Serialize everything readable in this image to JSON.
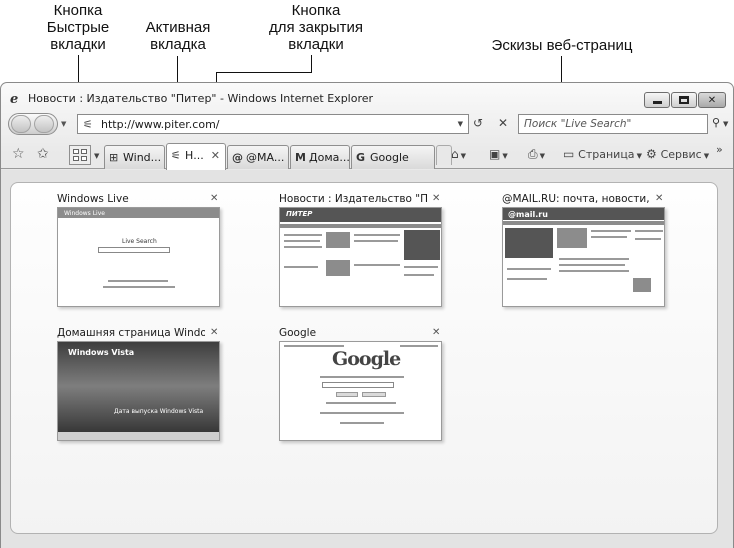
{
  "annotations": {
    "quick_tabs_button": [
      "Кнопка",
      "Быстрые",
      "вкладки"
    ],
    "active_tab": [
      "Активная",
      "вкладка"
    ],
    "close_tab_button": [
      "Кнопка",
      "для закрытия",
      "вкладки"
    ],
    "web_page_thumbnails": [
      "Эскизы веб-страниц"
    ]
  },
  "window": {
    "title": "Новости : Издательство \"Питер\" - Windows Internet Explorer"
  },
  "address_bar": {
    "url": "http://www.piter.com/"
  },
  "search": {
    "placeholder": "Поиск \"Live Search\""
  },
  "tabs": [
    {
      "label": "Wind...",
      "icon": "windows-icon",
      "active": false
    },
    {
      "label": "Н...",
      "icon": "piter-icon",
      "active": true
    },
    {
      "label": "@MA...",
      "icon": "at-icon",
      "active": false
    },
    {
      "label": "Дома...",
      "icon": "msn-icon",
      "active": false
    },
    {
      "label": "Google",
      "icon": "google-icon",
      "active": false
    }
  ],
  "command_bar": {
    "page_label": "Страница",
    "tools_label": "Сервис"
  },
  "thumbnails": [
    {
      "title": "Windows Live",
      "shot": {
        "brand": "Windows Live",
        "search_label": "Live Search"
      }
    },
    {
      "title": "Новости : Издательство \"Пи...",
      "shot": {
        "brand": "ПИТЕР"
      }
    },
    {
      "title": "@MAIL.RU: почта, новости, ...",
      "shot": {
        "brand": "@mail.ru"
      }
    },
    {
      "title": "Домашняя страница Windo...",
      "shot": {
        "brand": "Windows Vista",
        "caption": "Дата выпуска Windows Vista"
      }
    },
    {
      "title": "Google",
      "shot": {
        "brand": "Google"
      }
    }
  ]
}
